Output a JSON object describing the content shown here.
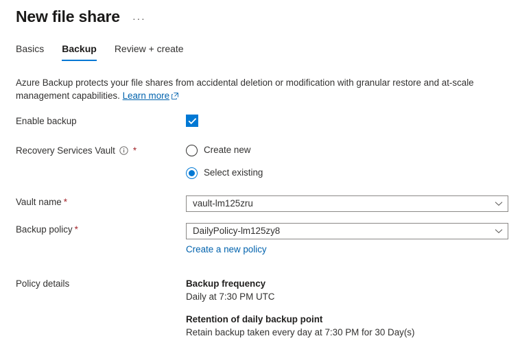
{
  "header": {
    "title": "New file share",
    "more_options": "···"
  },
  "tabs": [
    {
      "label": "Basics",
      "active": false
    },
    {
      "label": "Backup",
      "active": true
    },
    {
      "label": "Review + create",
      "active": false
    }
  ],
  "description": {
    "text": "Azure Backup protects your file shares from accidental deletion or modification with granular restore and at-scale management capabilities.",
    "link_label": "Learn more",
    "link_icon": "external-link-icon"
  },
  "form": {
    "enable_backup": {
      "label": "Enable backup",
      "checked": true,
      "icon": "checkmark-icon"
    },
    "recovery_services_vault": {
      "label": "Recovery Services Vault",
      "required_marker": "*",
      "info_icon": "info-icon",
      "options": [
        {
          "label": "Create new",
          "selected": false
        },
        {
          "label": "Select existing",
          "selected": true
        }
      ]
    },
    "vault_name": {
      "label": "Vault name",
      "required_marker": "*",
      "value": "vault-lm125zru",
      "icon": "chevron-down-icon"
    },
    "backup_policy": {
      "label": "Backup policy",
      "required_marker": "*",
      "value": "DailyPolicy-lm125zy8",
      "icon": "chevron-down-icon",
      "create_link": "Create a new policy"
    },
    "policy_details": {
      "label": "Policy details",
      "blocks": [
        {
          "heading": "Backup frequency",
          "body": "Daily at 7:30 PM UTC"
        },
        {
          "heading": "Retention of daily backup point",
          "body": "Retain backup taken every day at 7:30 PM for 30 Day(s)"
        }
      ]
    }
  },
  "colors": {
    "accent": "#0078d4",
    "link": "#0062ad",
    "required": "#a4262c",
    "text": "#323130"
  }
}
